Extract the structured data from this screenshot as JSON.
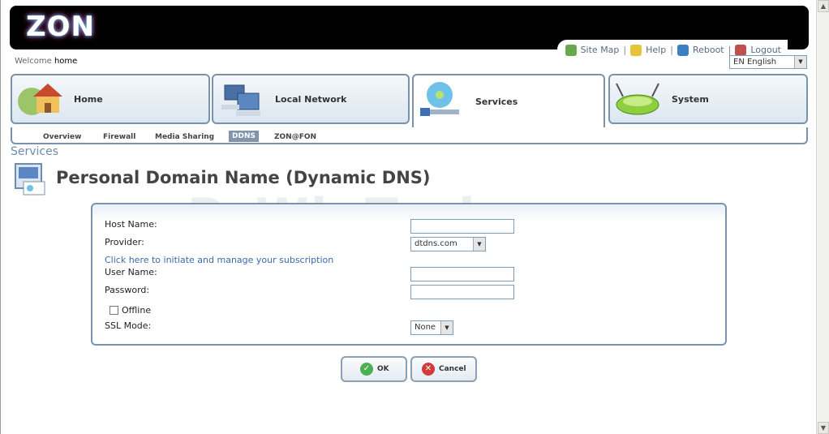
{
  "header": {
    "logo": "ZON"
  },
  "toplinks": [
    {
      "label": "Site Map",
      "icon": "site-map-icon",
      "color": "#6aa84f"
    },
    {
      "label": "Help",
      "icon": "help-icon",
      "color": "#e8c23a"
    },
    {
      "label": "Reboot",
      "icon": "reboot-icon",
      "color": "#3d7fc4"
    },
    {
      "label": "Logout",
      "icon": "logout-icon",
      "color": "#c0504d"
    }
  ],
  "welcome": {
    "prefix": "Welcome",
    "user": "home"
  },
  "language": {
    "selected": "EN English"
  },
  "tabs": [
    {
      "label": "Home",
      "icon": "home-icon"
    },
    {
      "label": "Local Network",
      "icon": "local-network-icon"
    },
    {
      "label": "Services",
      "icon": "services-icon",
      "active": true
    },
    {
      "label": "System",
      "icon": "system-icon"
    }
  ],
  "subnav": [
    "Overview",
    "Firewall",
    "Media Sharing",
    "DDNS",
    "ZON@FON"
  ],
  "subnav_active": "DDNS",
  "section_title": "Services",
  "page_title": "Personal Domain Name (Dynamic DNS)",
  "watermark": "PcWinTech.com",
  "form": {
    "host_name_label": "Host Name:",
    "host_name_value": "",
    "provider_label": "Provider:",
    "provider_value": "dtdns.com",
    "subscription_link": "Click here to initiate and manage your subscription",
    "user_name_label": "User Name:",
    "user_name_value": "",
    "password_label": "Password:",
    "password_value": "",
    "offline_label": "Offline",
    "offline_checked": false,
    "ssl_mode_label": "SSL Mode:",
    "ssl_mode_value": "None"
  },
  "buttons": {
    "ok": "OK",
    "cancel": "Cancel"
  },
  "colors": {
    "accent": "#7a93aa",
    "link": "#3b6aa6",
    "section": "#6b8db0"
  }
}
